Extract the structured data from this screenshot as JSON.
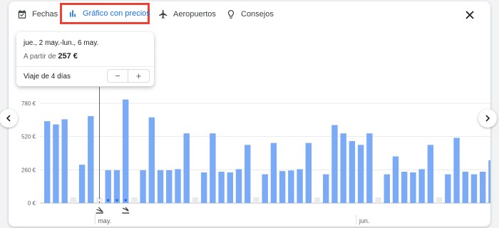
{
  "tabs": {
    "dates": "Fechas",
    "chart": "Gráfico con precios",
    "airports": "Aeropuertos",
    "tips": "Consejos"
  },
  "tooltip": {
    "dates": "jue., 2 may.-lun., 6 may.",
    "price_prefix": "A partir de",
    "price": "257 €",
    "trip_length": "Viaje de 4 días",
    "minus": "−",
    "plus": "+"
  },
  "icons": {
    "dates": "calendar-check-icon",
    "chart": "bar-chart-icon",
    "airports": "airplane-icon",
    "tips": "lightbulb-icon",
    "close": "close-icon",
    "prev": "chevron-left-icon",
    "next": "chevron-right-icon",
    "departure": "takeoff-icon",
    "return": "landing-icon"
  },
  "colors": {
    "bar": "#7baaf7",
    "bar_selected": "#1967d2",
    "bar_empty": "#e8eaed",
    "highlight": "#ea4335",
    "accent": "#1a73e8"
  },
  "chart_data": {
    "type": "bar",
    "x_labels": [
      {
        "label": "may.",
        "index": 6
      },
      {
        "label": "jun.",
        "index": 36
      }
    ],
    "y_ticks": [
      {
        "value": 0,
        "label": "0 €"
      },
      {
        "value": 260,
        "label": "260 €"
      },
      {
        "value": 520,
        "label": "520 €"
      },
      {
        "value": 780,
        "label": "780 €"
      }
    ],
    "ylim": [
      0,
      780
    ],
    "selected_index": 6,
    "dots_range": [
      6,
      9
    ],
    "values": [
      640,
      615,
      655,
      0,
      300,
      680,
      0,
      257,
      257,
      810,
      0,
      257,
      670,
      257,
      257,
      265,
      545,
      0,
      240,
      545,
      245,
      240,
      265,
      455,
      0,
      225,
      470,
      250,
      255,
      265,
      470,
      0,
      225,
      610,
      545,
      485,
      455,
      545,
      0,
      225,
      365,
      245,
      240,
      265,
      455,
      0,
      225,
      510,
      245,
      225,
      245,
      335,
      0,
      225,
      445,
      245,
      225,
      240,
      425
    ]
  }
}
